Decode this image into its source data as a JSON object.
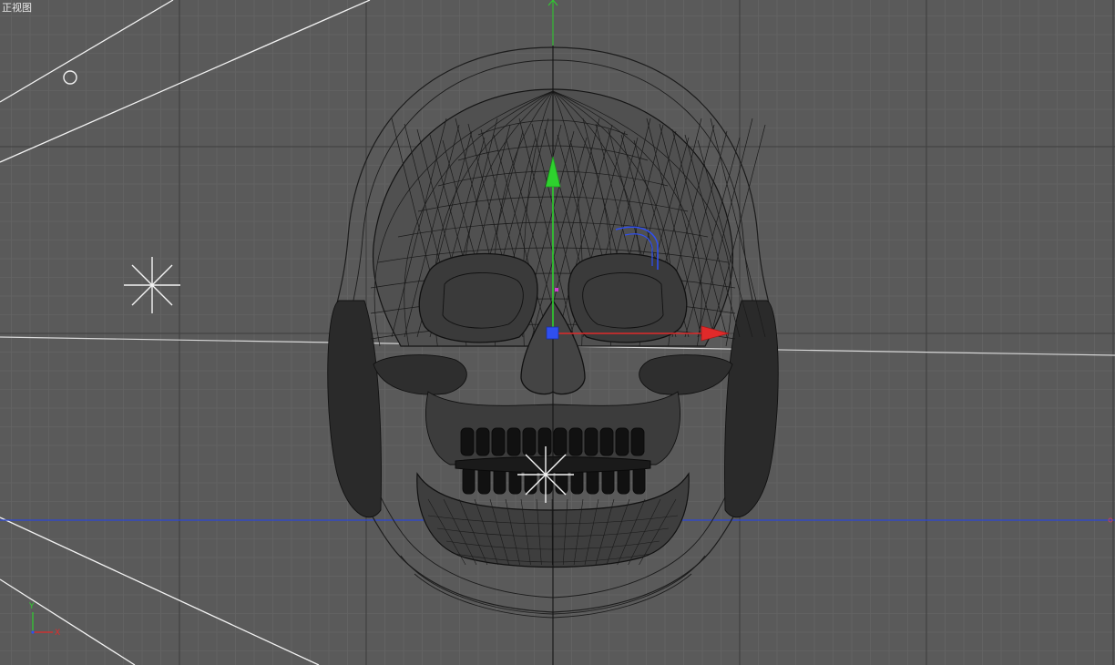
{
  "viewport": {
    "label": "正视图",
    "background": "#5a5a5a",
    "grid_minor_color": "#646464",
    "grid_major_color": "#3f3f3f"
  },
  "gizmo": {
    "x_color": "#e02a2a",
    "y_color": "#2ed12e",
    "z_color": "#2f4ff0"
  },
  "axis_indicator": {
    "x_label": "X",
    "y_label": "Y"
  },
  "scene_objects": {
    "mesh": "skull-wireframe",
    "lights": [
      "omni-light-star",
      "omni-light-star-center"
    ],
    "camera_marker": "circle-marker"
  }
}
